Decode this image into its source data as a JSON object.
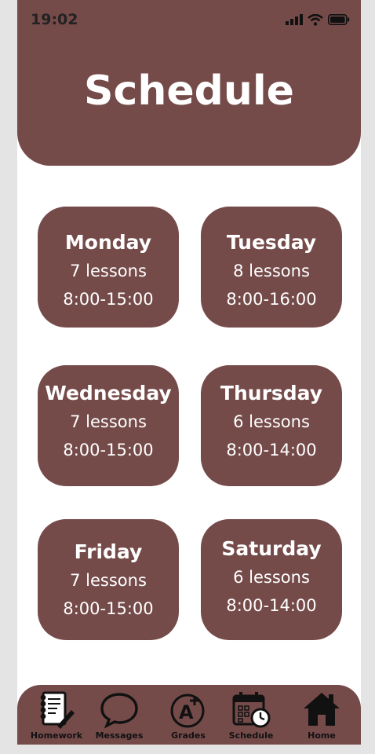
{
  "status_bar": {
    "time": "19:02"
  },
  "header": {
    "title": "Schedule"
  },
  "days": [
    {
      "day": "Monday",
      "lessons": "7 lessons",
      "hours": "8:00-15:00"
    },
    {
      "day": "Tuesday",
      "lessons": "8 lessons",
      "hours": "8:00-16:00"
    },
    {
      "day": "Wednesday",
      "lessons": "7 lessons",
      "hours": "8:00-15:00"
    },
    {
      "day": "Thursday",
      "lessons": "6 lessons",
      "hours": "8:00-14:00"
    },
    {
      "day": "Friday",
      "lessons": "7 lessons",
      "hours": "8:00-15:00"
    },
    {
      "day": "Saturday",
      "lessons": "6 lessons",
      "hours": "8:00-14:00"
    }
  ],
  "nav": [
    {
      "label": "Homework",
      "icon": "homework-icon"
    },
    {
      "label": "Messages",
      "icon": "messages-icon"
    },
    {
      "label": "Grades",
      "icon": "grades-icon"
    },
    {
      "label": "Schedule",
      "icon": "schedule-icon"
    },
    {
      "label": "Home",
      "icon": "home-icon"
    }
  ],
  "colors": {
    "primary": "#754b4a",
    "background": "#ffffff",
    "icon": "#111111"
  }
}
